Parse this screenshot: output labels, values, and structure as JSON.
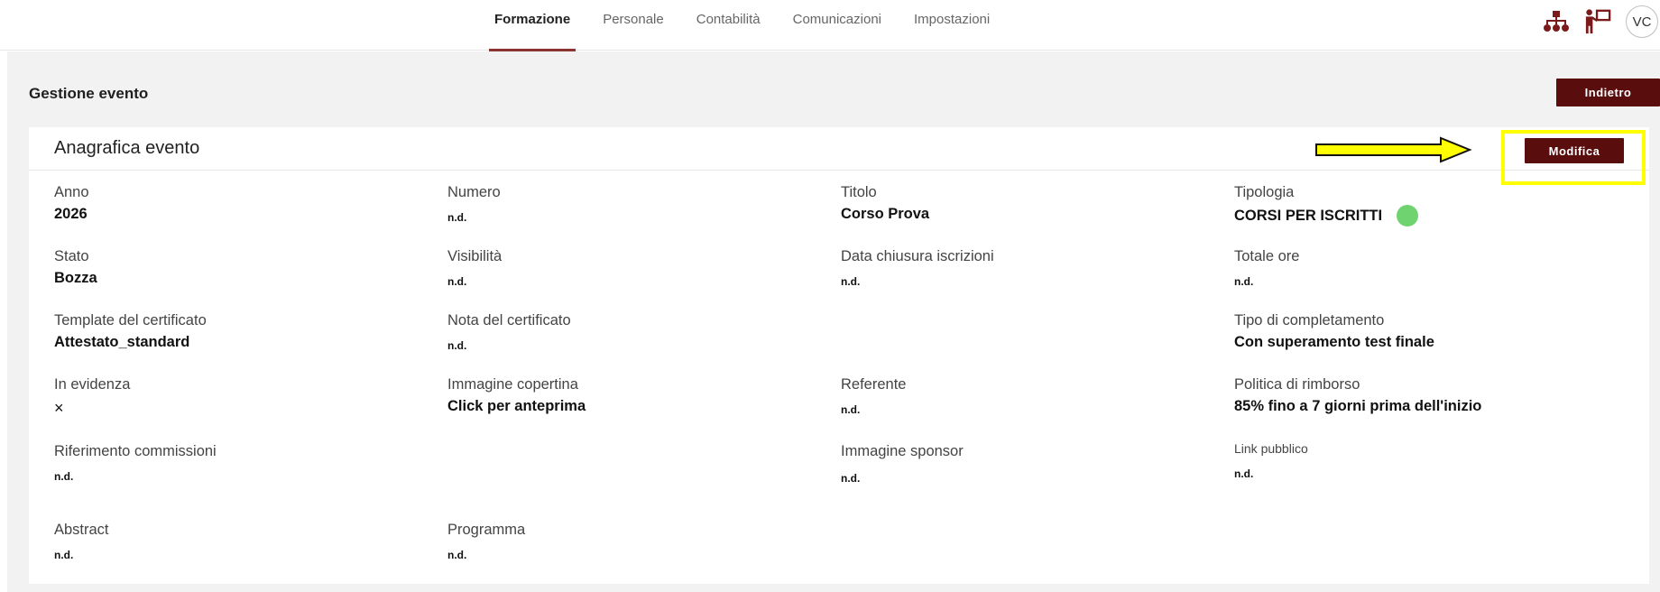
{
  "nav": {
    "tabs": [
      {
        "label": "Formazione",
        "active": true
      },
      {
        "label": "Personale",
        "active": false
      },
      {
        "label": "Contabilità",
        "active": false
      },
      {
        "label": "Comunicazioni",
        "active": false
      },
      {
        "label": "Impostazioni",
        "active": false
      }
    ],
    "icons": [
      "org-chart-icon",
      "presenter-icon"
    ],
    "avatar_initials": "VC"
  },
  "page": {
    "title": "Gestione evento",
    "back_label": "Indietro"
  },
  "card": {
    "title": "Anagrafica evento",
    "edit_label": "Modifica"
  },
  "fields": {
    "anno": {
      "label": "Anno",
      "value": "2026"
    },
    "numero": {
      "label": "Numero",
      "value": "n.d."
    },
    "titolo": {
      "label": "Titolo",
      "value": "Corso Prova"
    },
    "tipologia": {
      "label": "Tipologia",
      "value": "CORSI PER ISCRITTI"
    },
    "stato": {
      "label": "Stato",
      "value": "Bozza"
    },
    "visibilita": {
      "label": "Visibilità",
      "value": "n.d."
    },
    "data_chiusura": {
      "label": "Data chiusura iscrizioni",
      "value": "n.d."
    },
    "totale_ore": {
      "label": "Totale ore",
      "value": "n.d."
    },
    "template_certificato": {
      "label": "Template del certificato",
      "value": "Attestato_standard"
    },
    "nota_certificato": {
      "label": "Nota del certificato",
      "value": "n.d."
    },
    "tipo_completamento": {
      "label": "Tipo di completamento",
      "value": "Con superamento test finale"
    },
    "in_evidenza": {
      "label": "In evidenza",
      "value": "×"
    },
    "immagine_copertina": {
      "label": "Immagine copertina",
      "value": "Click per anteprima"
    },
    "referente": {
      "label": "Referente",
      "value": "n.d."
    },
    "politica_rimborso": {
      "label": "Politica di rimborso",
      "value": "85% fino a 7 giorni prima dell'inizio"
    },
    "riferimento_commissioni": {
      "label": "Riferimento commissioni",
      "value": "n.d."
    },
    "immagine_sponsor": {
      "label": "Immagine sponsor",
      "value": "n.d."
    },
    "link_pubblico": {
      "label": "Link pubblico",
      "value": "n.d."
    },
    "abstract": {
      "label": "Abstract",
      "value": "n.d."
    },
    "programma": {
      "label": "Programma",
      "value": "n.d."
    }
  },
  "colors": {
    "primary_button": "#5a0d0d",
    "active_tab_underline": "#8c3530",
    "status_dot": "#6fd46f",
    "annotation_highlight": "#ffff00"
  }
}
